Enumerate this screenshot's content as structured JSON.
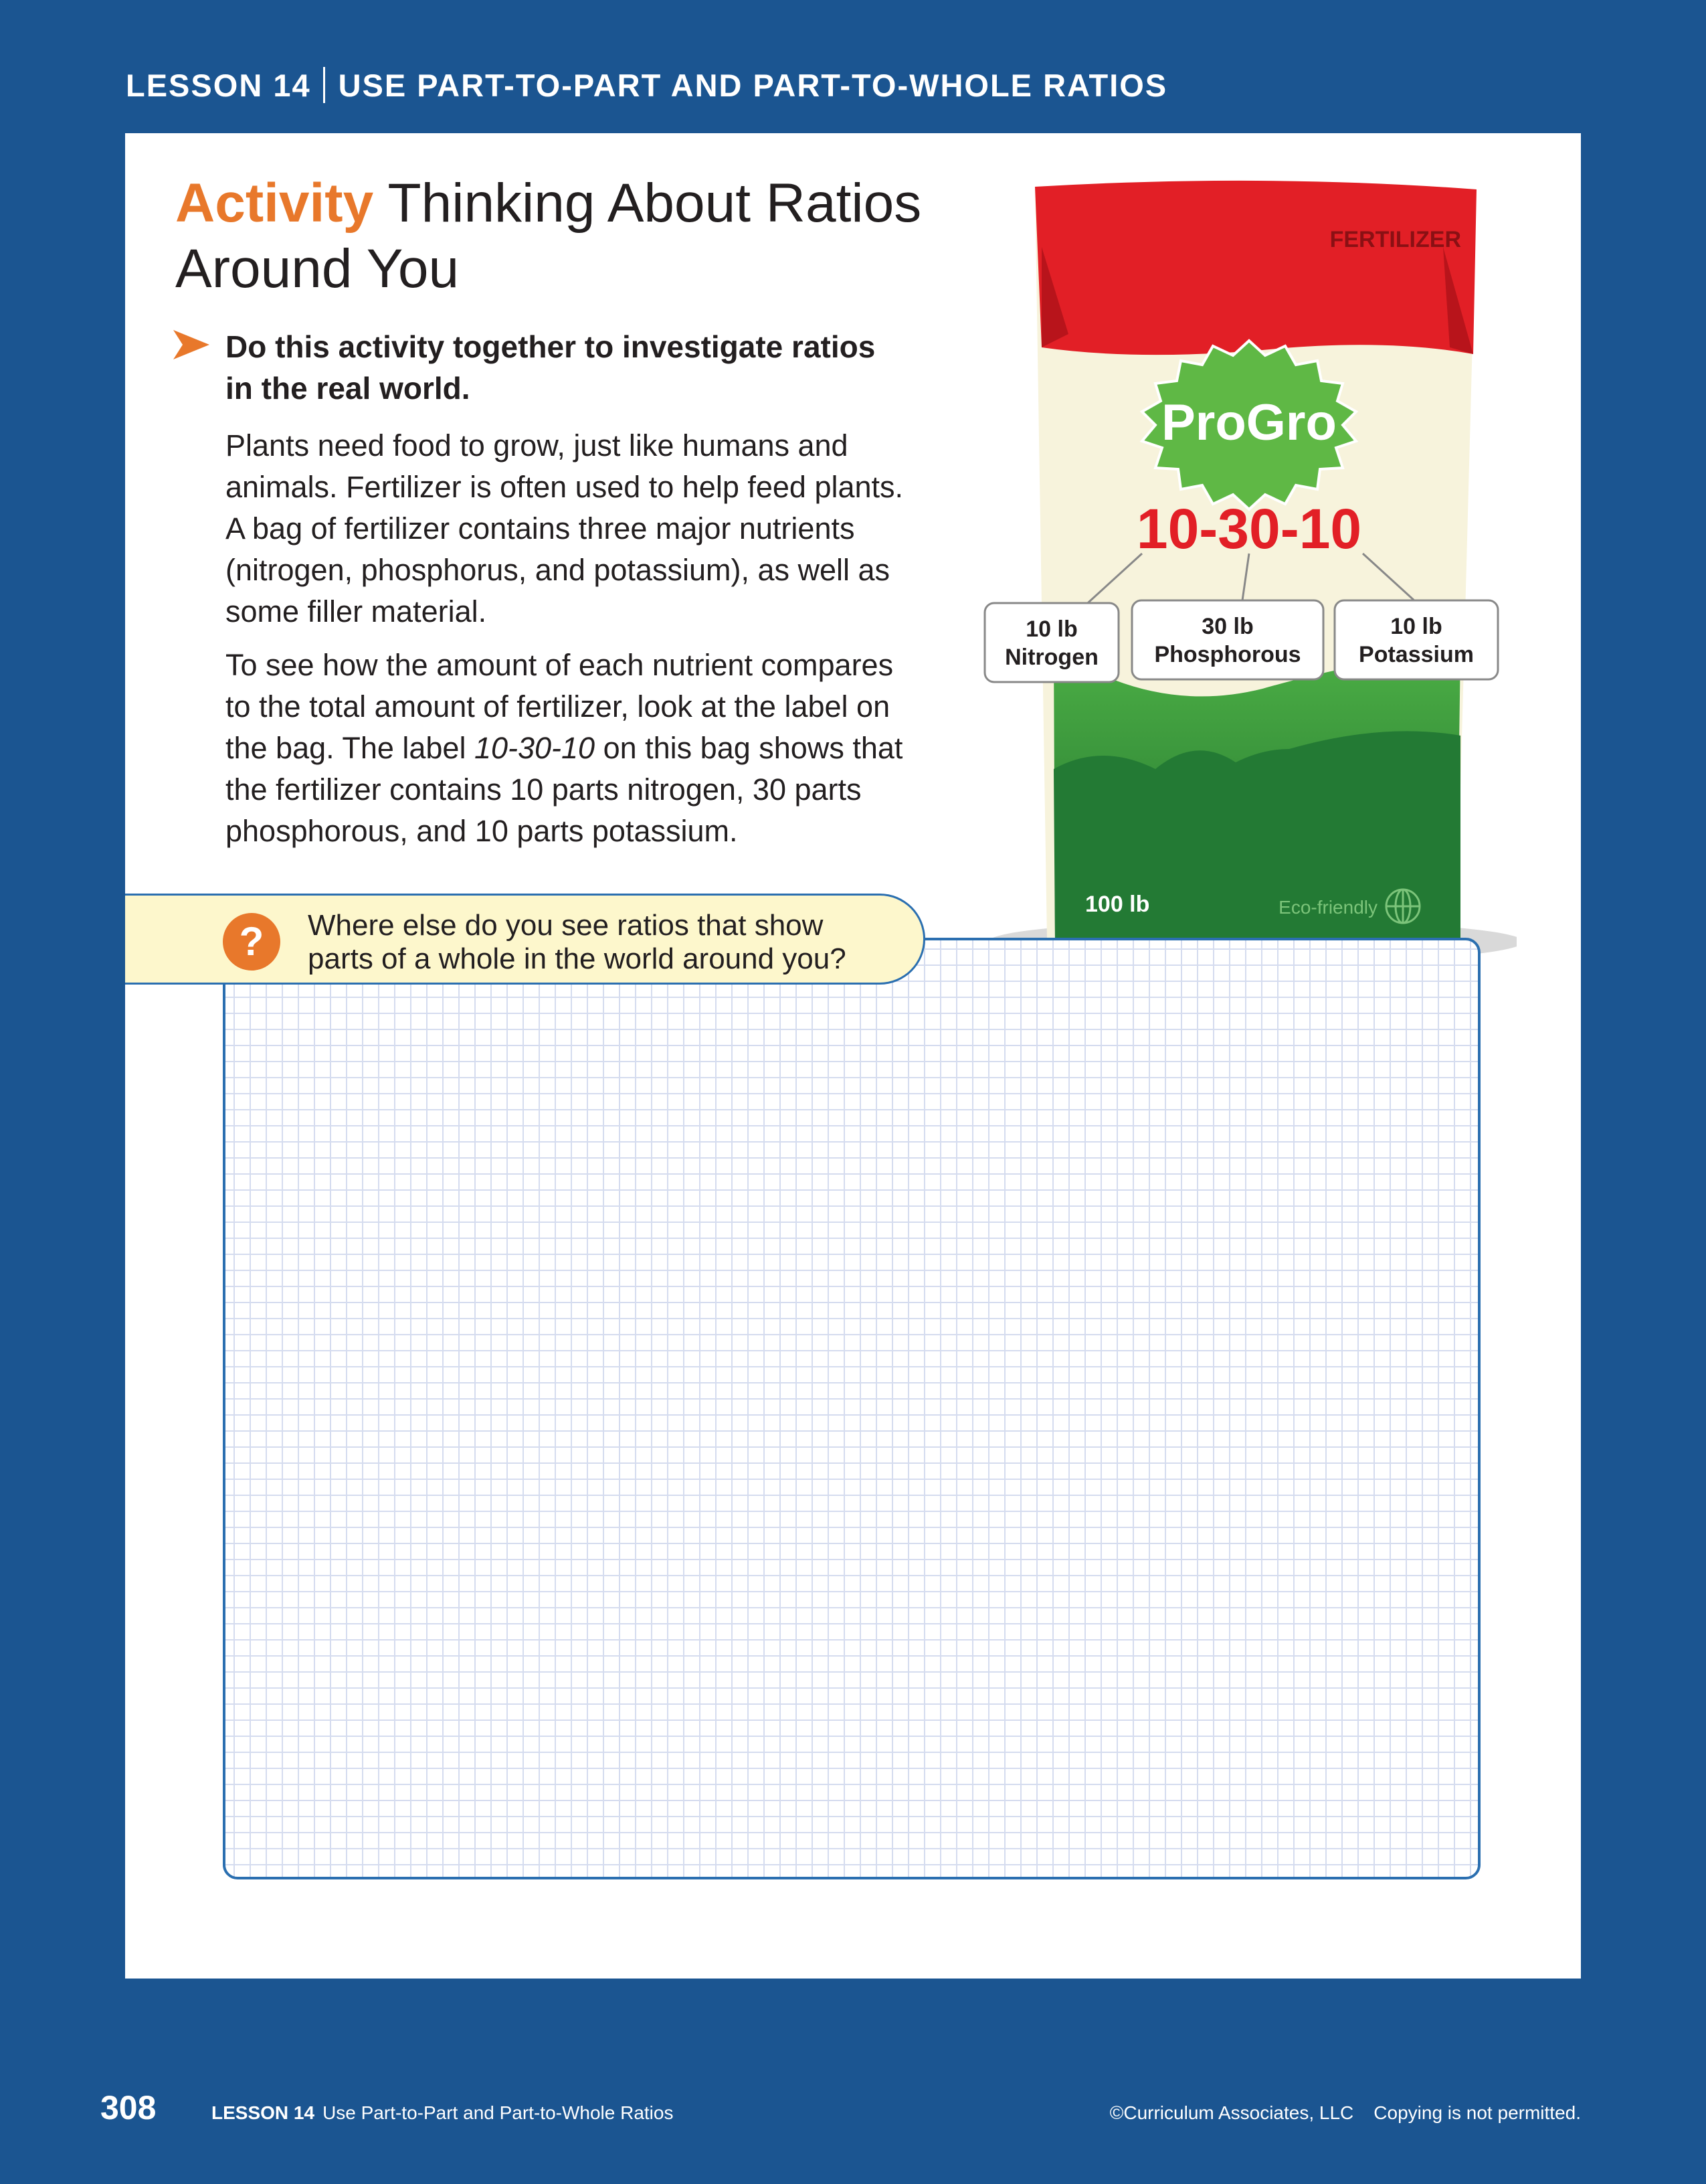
{
  "header": {
    "lesson": "LESSON 14",
    "title": "USE PART-TO-PART AND PART-TO-WHOLE RATIOS"
  },
  "activity": {
    "keyword": "Activity",
    "title_line1": "Thinking About Ratios",
    "title_line2": "Around You"
  },
  "instruction": {
    "line1": "Do this activity together to investigate ratios",
    "line2": "in the real world."
  },
  "paragraph1": [
    "Plants need food to grow, just like humans and",
    "animals. Fertilizer is often used to help feed plants.",
    "A bag of fertilizer contains three major nutrients",
    "(nitrogen, phosphorus, and potassium), as well as",
    "some filler material."
  ],
  "paragraph2": {
    "line1": "To see how the amount of each nutrient compares",
    "line2": "to the total amount of fertilizer, look at the label on",
    "line3_pre": "the bag. The label ",
    "line3_label": "10-30-10",
    "line3_post": " on this bag shows that",
    "line4": "the fertilizer contains 10 parts nitrogen, 30 parts",
    "line5": "phosphorous, and 10 parts potassium."
  },
  "bag": {
    "top_label": "FERTILIZER",
    "brand": "ProGro",
    "ratio": "10-30-10",
    "weight": "100 lb",
    "eco": "Eco-friendly",
    "labels": [
      {
        "amount": "10 lb",
        "name": "Nitrogen"
      },
      {
        "amount": "30 lb",
        "name": "Phosphorous"
      },
      {
        "amount": "10 lb",
        "name": "Potassium"
      }
    ]
  },
  "question": {
    "line1": "Where else do you see ratios that show",
    "line2": "parts of a whole in the world around you?"
  },
  "footer": {
    "page_number": "308",
    "lesson_label": "LESSON 14",
    "lesson_title": "Use Part-to-Part and Part-to-Whole Ratios",
    "copyright": "©Curriculum Associates, LLC",
    "notice": "Copying is not permitted."
  },
  "colors": {
    "background": "#1b5591",
    "accent_orange": "#e8782b",
    "bag_red": "#e21f26",
    "bag_green": "#3c9a3c",
    "callout_yellow": "#fdf7cc"
  }
}
